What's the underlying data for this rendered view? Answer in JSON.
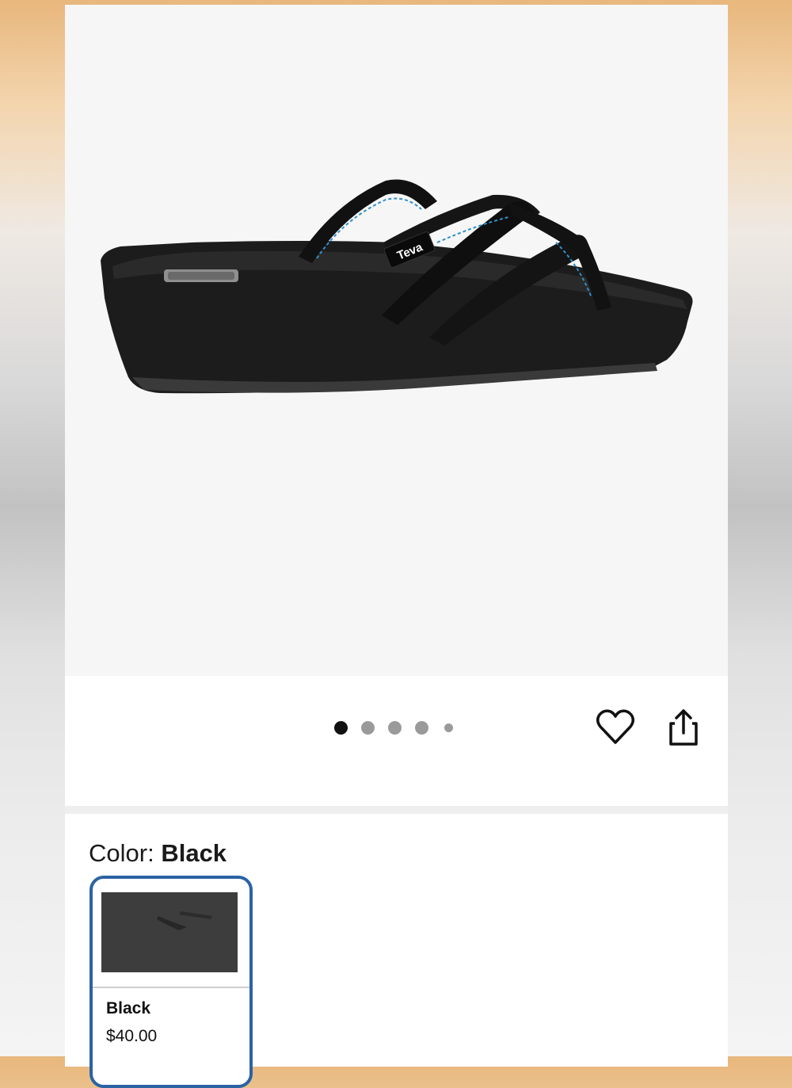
{
  "product": {
    "image_alt": "Black wedge strappy sandal",
    "logo_text": "Teva"
  },
  "carousel": {
    "dot_count": 5,
    "active_index": 0
  },
  "actions": {
    "favorite_icon": "heart-icon",
    "share_icon": "share-icon"
  },
  "color": {
    "label": "Color:",
    "selected": "Black"
  },
  "swatches": [
    {
      "name": "Black",
      "price": "$40.00"
    }
  ],
  "colors": {
    "selected_border": "#2a63a4",
    "active_dot": "#111111",
    "inactive_dot": "#9a9a9a"
  }
}
